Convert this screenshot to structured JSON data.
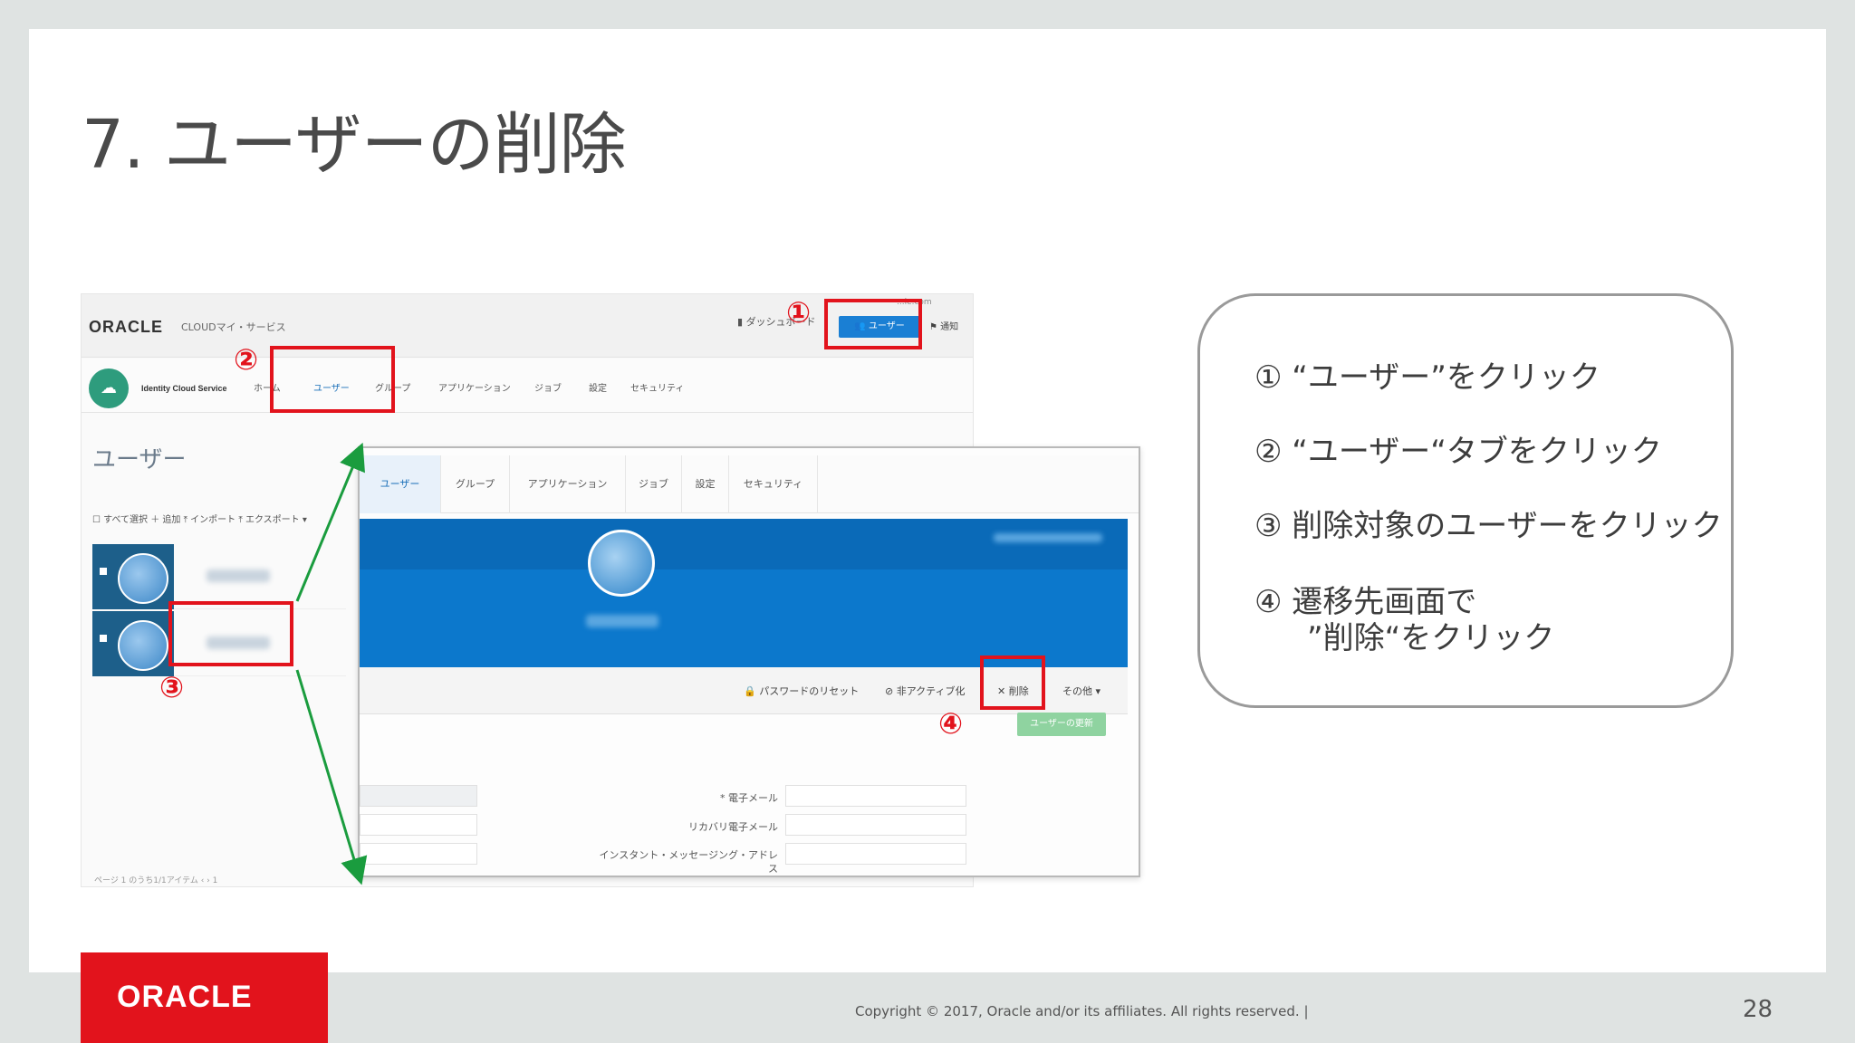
{
  "slide": {
    "title": "7. ユーザーの削除",
    "page_number": "28",
    "copyright": "Copyright © 2017, Oracle and/or its affiliates. All rights reserved.  |",
    "badge_logo": "ORACLE"
  },
  "screenshot1": {
    "logo": "ORACLE",
    "service_label": "CLOUDマイ・サービス",
    "dashboard_label": "ダッシュボード",
    "email_fragment": "...le.com",
    "users_button": "ユーザー",
    "notify_label": "通知",
    "identity_label": "Identity Cloud Service",
    "tabs": [
      "ホーム",
      "ユーザー",
      "グループ",
      "アプリケーション",
      "ジョブ",
      "設定",
      "セキュリティ"
    ],
    "page_title": "ユーザー",
    "toolbar": "☐ すべて選択   ＋ 追加   ⤒ インポート   ⤒ エクスポート ▾",
    "pagination": "ページ  1  のうち1/1アイテム  ‹  ›   1"
  },
  "screenshot2": {
    "tabs": [
      "ユーザー",
      "グループ",
      "アプリケーション",
      "ジョブ",
      "設定",
      "セキュリティ"
    ],
    "actions": {
      "reset_password": "🔒 パスワードのリセット",
      "deactivate": "⊘ 非アクティブ化",
      "delete": "✕ 削除",
      "more": "その他 ▾"
    },
    "update_button": "ユーザーの更新",
    "fields": [
      {
        "label": "* 電子メール"
      },
      {
        "label": "リカバリ電子メール"
      },
      {
        "label": "インスタント・メッセージング・アドレス"
      }
    ]
  },
  "markers": [
    "①",
    "②",
    "③",
    "④"
  ],
  "steps": [
    {
      "num": "①",
      "text": "“ユーザー”をクリック"
    },
    {
      "num": "②",
      "text": "“ユーザー“タブをクリック"
    },
    {
      "num": "③",
      "text": "削除対象のユーザーをクリック"
    },
    {
      "num": "④",
      "text": "遷移先画面で",
      "text2": "”削除“をクリック"
    }
  ],
  "colors": {
    "highlight": "#e2131c",
    "oracle_red": "#e2131c",
    "banner_blue": "#0c78cc",
    "arrow_green": "#1a9c3e"
  }
}
